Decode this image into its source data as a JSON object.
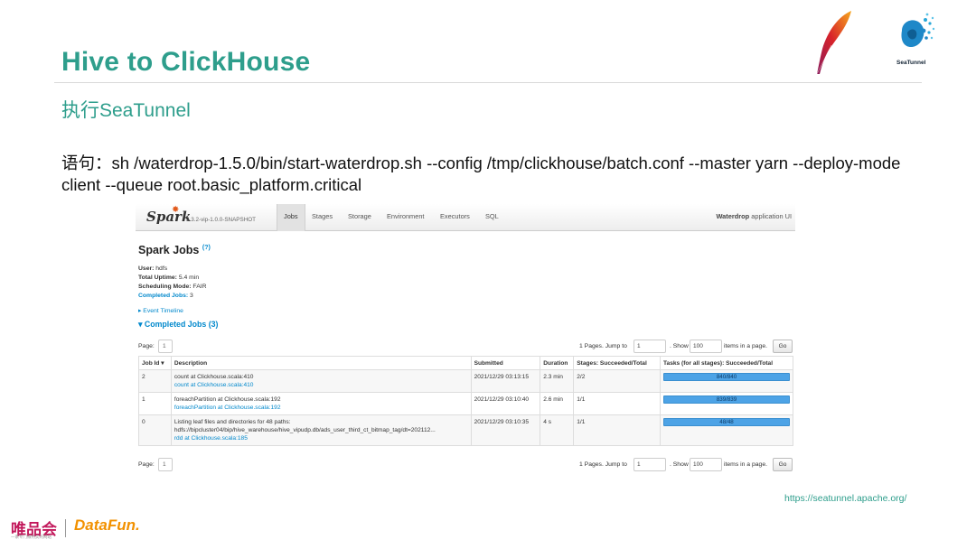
{
  "slide": {
    "title": "Hive to ClickHouse",
    "subtitle": "执行SeaTunnel",
    "command": "语句：sh /waterdrop-1.5.0/bin/start-waterdrop.sh --config /tmp/clickhouse/batch.conf --master yarn  --deploy-mode client --queue root.basic_platform.critical",
    "url": "https://seatunnel.apache.org/",
    "seatunnel_logo_text": "SeaTunnel",
    "footer_logo_vip": "唯品会",
    "footer_logo_vip_sub": "一家专门做特卖的网站",
    "footer_logo_datafun": "DataFun."
  },
  "spark": {
    "brand": "Spark",
    "version": "2.3.2-vip-1.0.0-SNAPSHOT",
    "tabs": [
      "Jobs",
      "Stages",
      "Storage",
      "Environment",
      "Executors",
      "SQL"
    ],
    "app_name": "Waterdrop",
    "app_suffix": "application UI",
    "heading": "Spark Jobs",
    "help": "(?)",
    "user_label": "User:",
    "user": "hdfs",
    "uptime_label": "Total Uptime:",
    "uptime": "5.4 min",
    "mode_label": "Scheduling Mode:",
    "mode": "FAIR",
    "completed_label": "Completed Jobs:",
    "completed": "3",
    "event_timeline": "▸ Event Timeline",
    "completed_heading": "▾ Completed Jobs (3)",
    "pager": {
      "page_label": "Page:",
      "page": "1",
      "pages_info": "1 Pages. Jump to",
      "jump": "1",
      "show_label": ". Show",
      "show": "100",
      "items_label": "items in a page.",
      "go": "Go"
    },
    "columns": [
      "Job Id ▾",
      "Description",
      "Submitted",
      "Duration",
      "Stages: Succeeded/Total",
      "Tasks (for all stages): Succeeded/Total"
    ],
    "rows": [
      {
        "id": "2",
        "desc": "count at Clickhouse.scala:410",
        "link": "count at Clickhouse.scala:410",
        "submitted": "2021/12/29 03:13:15",
        "duration": "2.3 min",
        "stages": "2/2",
        "tasks": "840/840",
        "progress": 1.0
      },
      {
        "id": "1",
        "desc": "foreachPartition at Clickhouse.scala:192",
        "link": "foreachPartition at Clickhouse.scala:192",
        "submitted": "2021/12/29 03:10:40",
        "duration": "2.6 min",
        "stages": "1/1",
        "tasks": "839/839",
        "progress": 1.0
      },
      {
        "id": "0",
        "desc": "Listing leaf files and directories for 48 paths:",
        "desc2": "hdfs://bipcluster04/bip/hive_warehouse/hive_vipudp.db/ads_user_third_ct_bitmap_tag/dt=202112...",
        "link": "rdd at Clickhouse.scala:185",
        "submitted": "2021/12/29 03:10:35",
        "duration": "4 s",
        "stages": "1/1",
        "tasks": "48/48",
        "progress": 1.0
      }
    ]
  }
}
